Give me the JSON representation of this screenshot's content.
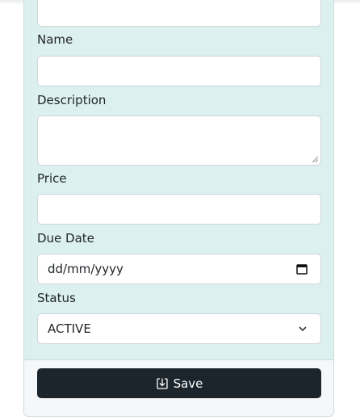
{
  "form": {
    "fields": {
      "name_label": "Name",
      "description_label": "Description",
      "price_label": "Price",
      "due_date_label": "Due Date",
      "due_date_value": "dd/mm/yyyy",
      "status_label": "Status",
      "status_value": "ACTIVE"
    },
    "save_label": "Save"
  },
  "icons": {
    "calendar": "calendar-icon",
    "chevron": "chevron-down-icon",
    "save": "save-icon"
  },
  "colors": {
    "form_background": "#dcf0ef",
    "button_background": "#1c252c",
    "input_border": "#ced4da"
  }
}
